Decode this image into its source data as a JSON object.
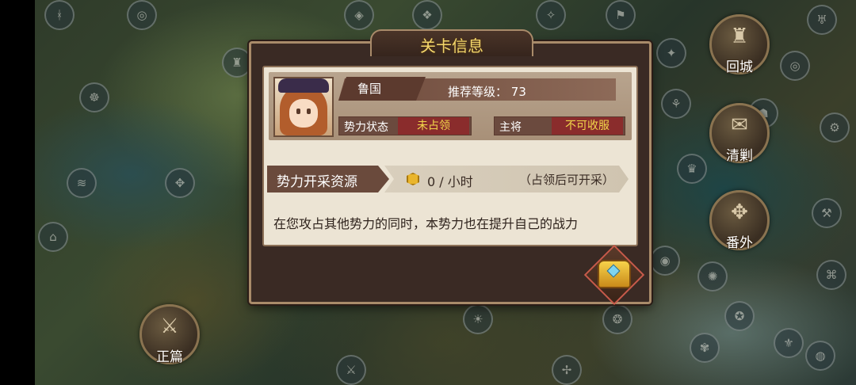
{
  "map": {
    "nodes": [
      "ᚼ",
      "◎",
      "♜",
      "☸",
      "≋",
      "✥",
      "⌂",
      "◈",
      "❖",
      "✧",
      "⚑",
      "✦",
      "◎",
      "♅",
      "⚘",
      "☗",
      "⚙",
      "♛",
      "⚒",
      "◉",
      "✺",
      "⌘",
      "❂",
      "✾",
      "⚜",
      "☀",
      "✢",
      "⚔",
      "◍",
      "✪"
    ]
  },
  "side_menu": {
    "return_city": "回城",
    "campaign": "清剿",
    "extra": "番外",
    "main_story": "正篇"
  },
  "dialog": {
    "title": "关卡信息",
    "hero": {
      "name": "鲁国",
      "level_label": "推荐等级：",
      "level_value": "73"
    },
    "status": {
      "faction_label": "势力状态",
      "faction_value": "未占领",
      "general_label": "主将",
      "general_value": "不可收服"
    },
    "resource": {
      "label": "势力开采资源",
      "amount": "0 / 小时",
      "note": "（占领后可开采）"
    },
    "description": "在您攻占其他势力的同时，本势力也在提升自己的战力"
  },
  "colors": {
    "title_gold": "#f3d66a",
    "status_value_bg": "#8a2c2c",
    "status_value_text": "#f2d84a",
    "panel_bg": "#ece4d4"
  }
}
